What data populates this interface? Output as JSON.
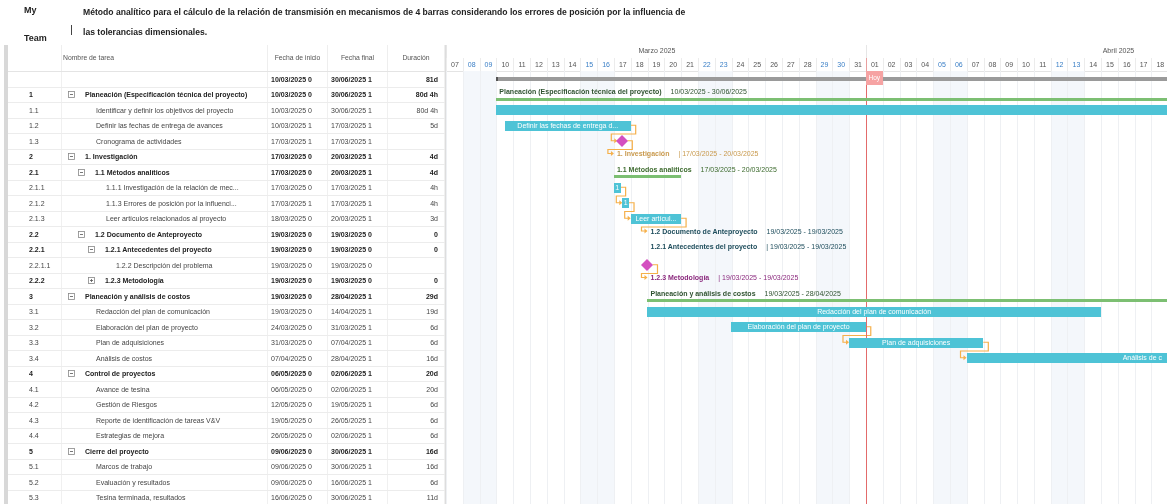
{
  "header": {
    "team_top": "My",
    "team_bottom": "Team",
    "title": "Método analítico para el cálculo de la relación de transmisión en mecanismos de 4 barras considerando los errores de posición por la influencia de las tolerancias dimensionales."
  },
  "table": {
    "columns": [
      "Nombre de tarea",
      "Fecha de inicio",
      "Fecha final",
      "Duración"
    ],
    "total": {
      "start": "10/03/2025 0",
      "end": "30/06/2025 1",
      "duration": "81d",
      "bold": true,
      "gantt": {
        "kind": "project"
      }
    },
    "rows": [
      {
        "id": "1",
        "name": "Planeación (Especificación técnica del proyecto)",
        "start": "10/03/2025 0",
        "end": "30/06/2025 1",
        "duration": "80d 4h",
        "bold": true,
        "expanded": true,
        "gantt": {
          "kind": "summary",
          "label": "Planeación (Especificación técnica del proyecto)",
          "dates": "10/03/2025 - 30/06/2025",
          "line": true,
          "color": "#2f5230"
        },
        "children": [
          {
            "id": "1.1",
            "name": "Identificar y definir los objetivos del proyecto",
            "start": "10/03/2025 0",
            "end": "30/06/2025 1",
            "duration": "80d 4h",
            "bold": false,
            "gantt": {
              "kind": "task"
            }
          },
          {
            "id": "1.2",
            "name": "Definir las fechas de entrega de avances",
            "start": "10/03/2025 1",
            "end": "17/03/2025 1",
            "duration": "5d",
            "bold": false,
            "gantt": {
              "kind": "task",
              "label": "Definir las fechas de entrega d..."
            }
          },
          {
            "id": "1.3",
            "name": "Cronograma de actividades",
            "start": "17/03/2025 1",
            "end": "17/03/2025 1",
            "bold": false,
            "gantt": {
              "kind": "milestone",
              "linked": true
            }
          }
        ]
      },
      {
        "id": "2",
        "name": "1. Investigación",
        "start": "17/03/2025 0",
        "end": "20/03/2025 1",
        "duration": "4d",
        "bold": true,
        "expanded": true,
        "gantt": {
          "kind": "summary",
          "label": "1. Investigación",
          "dates": "| 17/03/2025 - 20/03/2025",
          "linked": true,
          "color": "#c99a4e"
        },
        "children": [
          {
            "id": "2.1",
            "name": "1.1 Métodos analíticos",
            "start": "17/03/2025 0",
            "end": "20/03/2025 1",
            "duration": "4d",
            "bold": true,
            "expanded": true,
            "gantt": {
              "kind": "summary",
              "label": "1.1 Métodos analíticos",
              "dates": "17/03/2025 - 20/03/2025",
              "line": true,
              "color": "#3d6b2e"
            },
            "children": [
              {
                "id": "2.1.1",
                "name": "1.1.1 Investigación de la relación de mec...",
                "start": "17/03/2025 0",
                "end": "17/03/2025 1",
                "duration": "4h",
                "bold": false,
                "gantt": {
                  "kind": "task",
                  "label": "1"
                }
              },
              {
                "id": "2.1.2",
                "name": "1.1.3 Errores de posición por la influenci...",
                "start": "17/03/2025 1",
                "end": "17/03/2025 1",
                "duration": "4h",
                "bold": false,
                "gantt": {
                  "kind": "task",
                  "label": "1",
                  "linked": true
                }
              },
              {
                "id": "2.1.3",
                "name": "Leer artículos relacionados al proyecto",
                "start": "18/03/2025 0",
                "end": "20/03/2025 1",
                "duration": "3d",
                "bold": false,
                "gantt": {
                  "kind": "task",
                  "label": "Leer artícul...",
                  "linked": true
                }
              }
            ]
          },
          {
            "id": "2.2",
            "name": "1.2 Documento de Anteproyecto",
            "start": "19/03/2025 0",
            "end": "19/03/2025 0",
            "duration": "0",
            "bold": true,
            "expanded": true,
            "gantt": {
              "kind": "summary",
              "label": "1.2 Documento de Anteproyecto",
              "dates": "19/03/2025 - 19/03/2025",
              "linked": true,
              "color": "#1e4d5c"
            },
            "children": [
              {
                "id": "2.2.1",
                "name": "1.2.1 Antecedentes del proyecto",
                "start": "19/03/2025 0",
                "end": "19/03/2025 0",
                "duration": "0",
                "bold": true,
                "expanded": true,
                "gantt": {
                  "kind": "summary",
                  "label": "1.2.1 Antecedentes del proyecto",
                  "dates": "| 19/03/2025 - 19/03/2025",
                  "color": "#1e4d5c"
                },
                "children": [
                  {
                    "id": "2.2.1.1",
                    "name": "1.2.2 Descripción del problema",
                    "start": "19/03/2025 0",
                    "end": "19/03/2025 0",
                    "bold": false,
                    "gantt": {
                      "kind": "milestone"
                    }
                  }
                ]
              },
              {
                "id": "2.2.2",
                "name": "1.2.3 Metodología",
                "start": "19/03/2025 0",
                "end": "19/03/2025 0",
                "duration": "0",
                "bold": true,
                "expanded": false,
                "gantt": {
                  "kind": "summary",
                  "label": "1.2.3 Metodología",
                  "dates": "| 19/03/2025 - 19/03/2025",
                  "linked": true,
                  "color": "#8b2a7e"
                }
              }
            ]
          }
        ]
      },
      {
        "id": "3",
        "name": "Planeación y análisis de costos",
        "start": "19/03/2025 0",
        "end": "28/04/2025 1",
        "duration": "29d",
        "bold": true,
        "expanded": true,
        "gantt": {
          "kind": "summary",
          "label": "Planeación y análisis de costos",
          "dates": "19/03/2025 - 28/04/2025",
          "line": true,
          "color": "#2f5230"
        },
        "children": [
          {
            "id": "3.1",
            "name": "Redacción del plan de comunicación",
            "start": "19/03/2025 0",
            "end": "14/04/2025 1",
            "duration": "19d",
            "bold": false,
            "gantt": {
              "kind": "task",
              "label": "Redacción del plan de comunicación"
            }
          },
          {
            "id": "3.2",
            "name": "Elaboración del plan de proyecto",
            "start": "24/03/2025 0",
            "end": "31/03/2025 1",
            "duration": "6d",
            "bold": false,
            "gantt": {
              "kind": "task",
              "label": "Elaboración del plan de proyecto"
            }
          },
          {
            "id": "3.3",
            "name": "Plan de adquisiciones",
            "start": "31/03/2025 0",
            "end": "07/04/2025 1",
            "duration": "6d",
            "bold": false,
            "gantt": {
              "kind": "task",
              "label": "Plan de adquisiciones",
              "linked": true
            }
          },
          {
            "id": "3.4",
            "name": "Análisis de costos",
            "start": "07/04/2025 0",
            "end": "28/04/2025 1",
            "duration": "16d",
            "bold": false,
            "gantt": {
              "kind": "task",
              "label": "Análisis de c",
              "linked": true
            }
          }
        ]
      },
      {
        "id": "4",
        "name": "Control de proyectos",
        "start": "06/05/2025 0",
        "end": "02/06/2025 1",
        "duration": "20d",
        "bold": true,
        "expanded": true,
        "children": [
          {
            "id": "4.1",
            "name": "Avance de tesina",
            "start": "06/05/2025 0",
            "end": "02/06/2025 1",
            "duration": "20d",
            "bold": false
          },
          {
            "id": "4.2",
            "name": "Gestión de Riesgos",
            "start": "12/05/2025 0",
            "end": "19/05/2025 1",
            "duration": "6d",
            "bold": false
          },
          {
            "id": "4.3",
            "name": "Reporte de identificación de tareas V&V",
            "start": "19/05/2025 0",
            "end": "26/05/2025 1",
            "duration": "6d",
            "bold": false
          },
          {
            "id": "4.4",
            "name": "Estrategias de mejora",
            "start": "26/05/2025 0",
            "end": "02/06/2025 1",
            "duration": "6d",
            "bold": false
          }
        ]
      },
      {
        "id": "5",
        "name": "Cierre del proyecto",
        "start": "09/06/2025 0",
        "end": "30/06/2025 1",
        "duration": "16d",
        "bold": true,
        "expanded": true,
        "children": [
          {
            "id": "5.1",
            "name": "Marcos de trabajo",
            "start": "09/06/2025 0",
            "end": "30/06/2025 1",
            "duration": "16d",
            "bold": false
          },
          {
            "id": "5.2",
            "name": "Evaluación y resultados",
            "start": "09/06/2025 0",
            "end": "16/06/2025 1",
            "duration": "6d",
            "bold": false
          },
          {
            "id": "5.3",
            "name": "Tesina terminada, resultados",
            "start": "16/06/2025 0",
            "end": "30/06/2025 1",
            "duration": "11d",
            "bold": false
          }
        ]
      }
    ]
  },
  "timeline": {
    "today_label": "Hoy",
    "months": [
      {
        "label": "Marzo 2025",
        "days": [
          {
            "label": "07",
            "weekend": false,
            "today": false
          },
          {
            "label": "08",
            "weekend": true,
            "today": false
          },
          {
            "label": "09",
            "weekend": true,
            "today": false
          },
          {
            "label": "10",
            "weekend": false,
            "today": false
          },
          {
            "label": "11",
            "weekend": false,
            "today": false
          },
          {
            "label": "12",
            "weekend": false,
            "today": false
          },
          {
            "label": "13",
            "weekend": false,
            "today": false
          },
          {
            "label": "14",
            "weekend": false,
            "today": false
          },
          {
            "label": "15",
            "weekend": true,
            "today": false
          },
          {
            "label": "16",
            "weekend": true,
            "today": false
          },
          {
            "label": "17",
            "weekend": false,
            "today": false
          },
          {
            "label": "18",
            "weekend": false,
            "today": false
          },
          {
            "label": "19",
            "weekend": false,
            "today": false
          },
          {
            "label": "20",
            "weekend": false,
            "today": false
          },
          {
            "label": "21",
            "weekend": false,
            "today": false
          },
          {
            "label": "22",
            "weekend": true,
            "today": false
          },
          {
            "label": "23",
            "weekend": true,
            "today": false
          },
          {
            "label": "24",
            "weekend": false,
            "today": false
          },
          {
            "label": "25",
            "weekend": false,
            "today": false
          },
          {
            "label": "26",
            "weekend": false,
            "today": false
          },
          {
            "label": "27",
            "weekend": false,
            "today": false
          },
          {
            "label": "28",
            "weekend": false,
            "today": false
          },
          {
            "label": "29",
            "weekend": true,
            "today": false
          },
          {
            "label": "30",
            "weekend": true,
            "today": false
          },
          {
            "label": "31",
            "weekend": false,
            "today": false
          }
        ]
      },
      {
        "label": "Abril 2025",
        "days": [
          {
            "label": "01",
            "weekend": false,
            "today": true
          },
          {
            "label": "02",
            "weekend": false,
            "today": false
          },
          {
            "label": "03",
            "weekend": false,
            "today": false
          },
          {
            "label": "04",
            "weekend": false,
            "today": false
          },
          {
            "label": "05",
            "weekend": true,
            "today": false
          },
          {
            "label": "06",
            "weekend": true,
            "today": false
          },
          {
            "label": "07",
            "weekend": false,
            "today": false
          },
          {
            "label": "08",
            "weekend": false,
            "today": false
          },
          {
            "label": "09",
            "weekend": false,
            "today": false
          },
          {
            "label": "10",
            "weekend": false,
            "today": false
          },
          {
            "label": "11",
            "weekend": false,
            "today": false
          },
          {
            "label": "12",
            "weekend": true,
            "today": false
          },
          {
            "label": "13",
            "weekend": true,
            "today": false
          },
          {
            "label": "14",
            "weekend": false,
            "today": false
          },
          {
            "label": "15",
            "weekend": false,
            "today": false
          },
          {
            "label": "16",
            "weekend": false,
            "today": false
          },
          {
            "label": "17",
            "weekend": false,
            "today": false
          },
          {
            "label": "18",
            "weekend": false,
            "today": false
          }
        ]
      }
    ]
  }
}
